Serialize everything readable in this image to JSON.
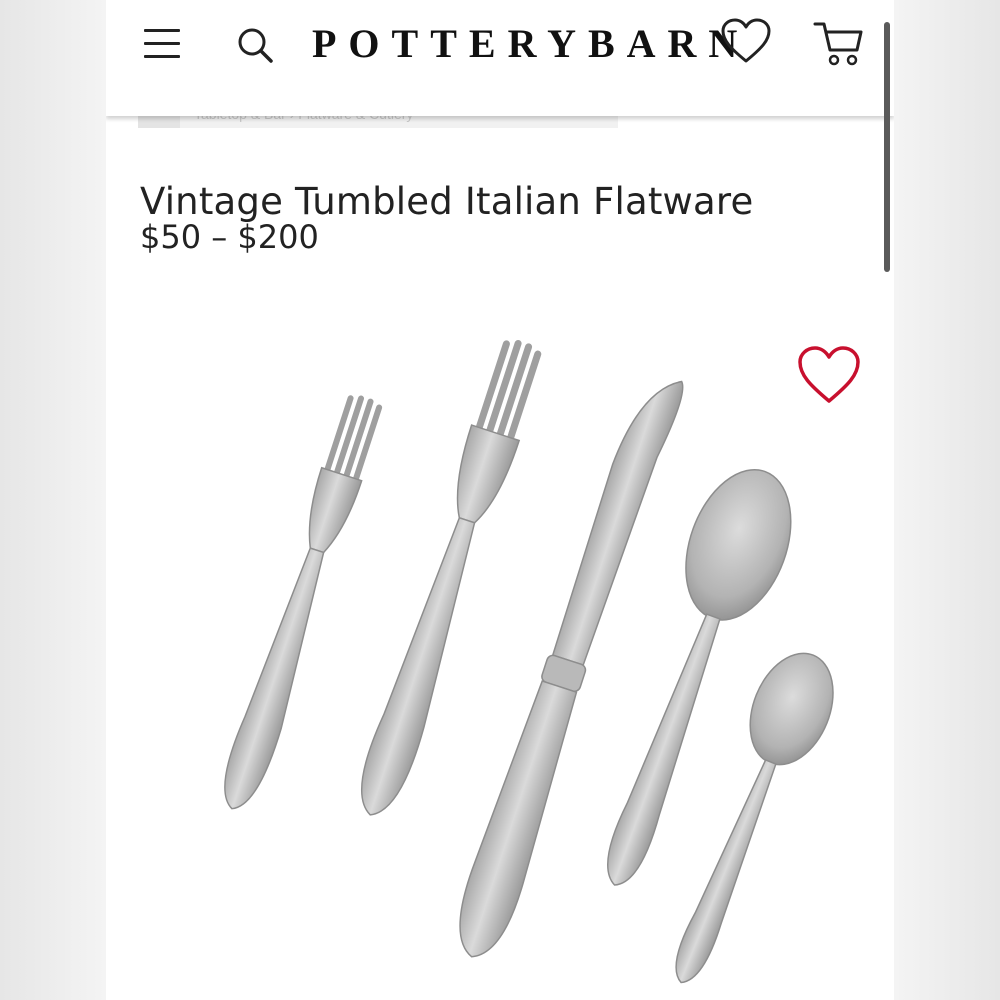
{
  "header": {
    "logo_text": "POTTERYBARN",
    "icons": [
      "menu-icon",
      "search-icon",
      "heart-icon",
      "cart-icon"
    ]
  },
  "breadcrumb": {
    "text": "Tabletop & Bar  ›  Flatware & Cutlery"
  },
  "product": {
    "title": "Vintage Tumbled Italian Flatware",
    "price_range": "$50 – $200",
    "wishlist_icon": "heart-outline-icon",
    "wishlist_color": "#c8102e",
    "image_pieces": [
      "salad-fork",
      "dinner-fork",
      "dinner-knife",
      "dinner-spoon",
      "teaspoon"
    ],
    "finish_color": "#c9c9c9"
  }
}
